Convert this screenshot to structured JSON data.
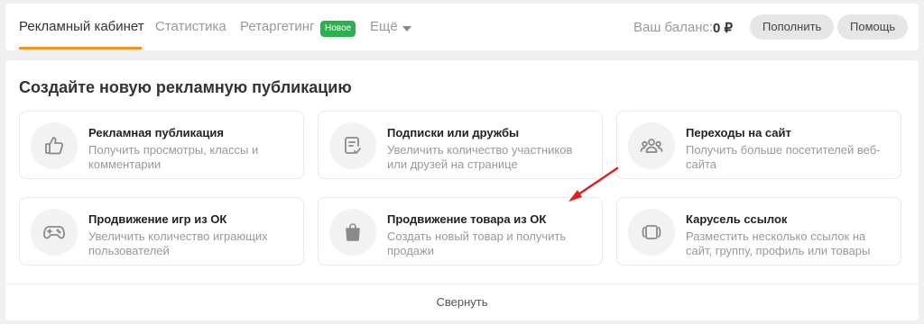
{
  "nav": {
    "tabs": [
      {
        "label": "Рекламный кабинет",
        "active": true
      },
      {
        "label": "Статистика"
      },
      {
        "label": "Ретаргетинг",
        "badge": "Новое"
      },
      {
        "label": "Ещё"
      }
    ],
    "balance_label": "Ваш баланс:",
    "balance_value": "0 ₽",
    "topup_label": "Пополнить",
    "help_label": "Помощь"
  },
  "colors": {
    "accent": "#f7931e",
    "badge": "#2db04e",
    "arrow": "#e02020"
  },
  "main": {
    "title": "Создайте новую рекламную публикацию",
    "cards": [
      {
        "icon": "thumbs-up-icon",
        "title": "Рекламная публикация",
        "desc": "Получить просмотры, классы и комментарии"
      },
      {
        "icon": "edit-check-icon",
        "title": "Подписки или дружбы",
        "desc": "Увеличить количество участников или друзей на странице"
      },
      {
        "icon": "users-group-icon",
        "title": "Переходы на сайт",
        "desc": "Получить больше посетителей веб-сайта"
      },
      {
        "icon": "gamepad-icon",
        "title": "Продвижение игр из ОК",
        "desc": "Увеличить количество играющих пользователей"
      },
      {
        "icon": "shopping-bag-icon",
        "title": "Продвижение товара из ОК",
        "desc": "Создать новый товар и получить продажи"
      },
      {
        "icon": "carousel-icon",
        "title": "Карусель ссылок",
        "desc": "Разместить несколько ссылок на сайт, группу, профиль или товары"
      }
    ],
    "collapse_label": "Свернуть"
  }
}
